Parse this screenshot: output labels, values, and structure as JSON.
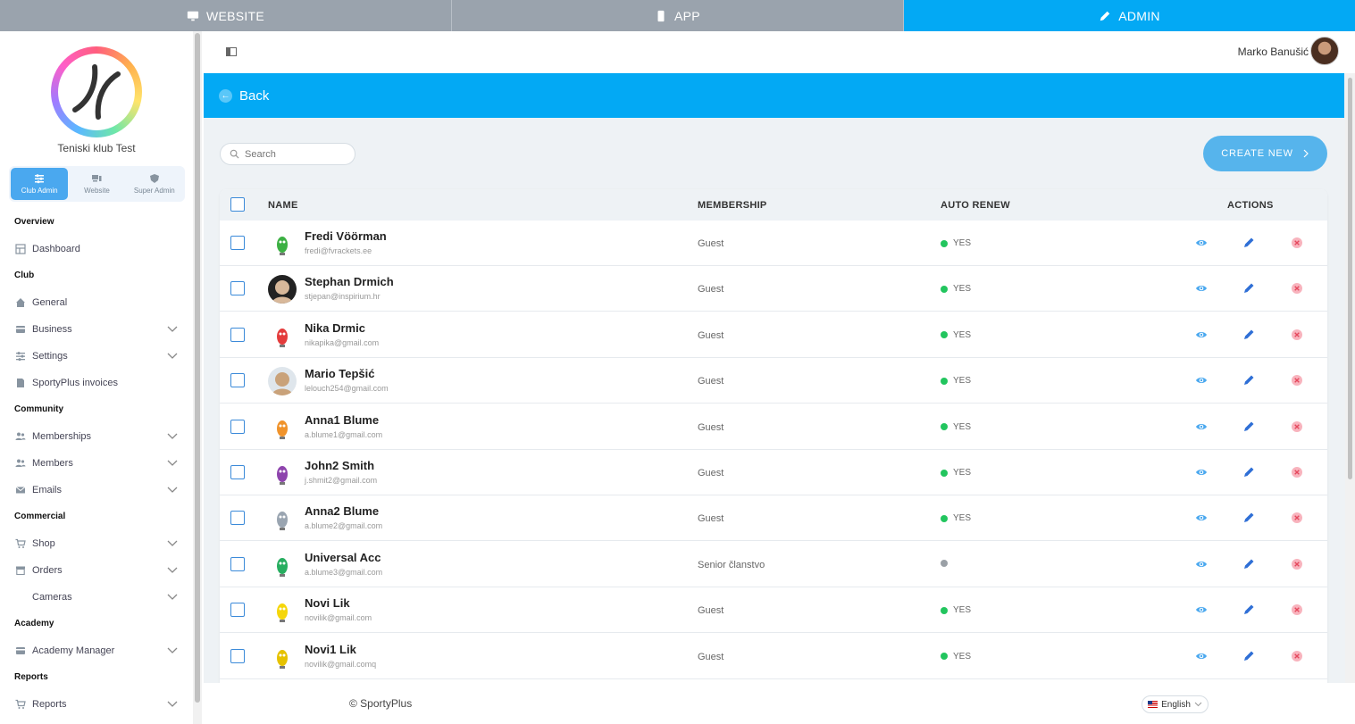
{
  "topbar": {
    "tabs": [
      {
        "label": "WEBSITE",
        "icon": "monitor-icon"
      },
      {
        "label": "APP",
        "icon": "phone-icon"
      },
      {
        "label": "ADMIN",
        "icon": "pencil-icon",
        "active": true
      }
    ]
  },
  "sidebar": {
    "club_name": "Teniski klub Test",
    "roles": [
      {
        "label": "Club Admin",
        "active": true
      },
      {
        "label": "Website"
      },
      {
        "label": "Super Admin"
      }
    ],
    "sections": {
      "overview": "Overview",
      "club": "Club",
      "community": "Community",
      "commercial": "Commercial",
      "academy": "Academy",
      "reports": "Reports"
    },
    "items": {
      "dashboard": "Dashboard",
      "general": "General",
      "business": "Business",
      "settings": "Settings",
      "invoices": "SportyPlus invoices",
      "memberships": "Memberships",
      "members": "Members",
      "emails": "Emails",
      "shop": "Shop",
      "orders": "Orders",
      "cameras": "Cameras",
      "academy_manager": "Academy Manager",
      "reports": "Reports"
    }
  },
  "header": {
    "user_name": "Marko Banušić"
  },
  "back": {
    "label": "Back"
  },
  "toolbar": {
    "search_placeholder": "Search",
    "create_label": "CREATE NEW"
  },
  "table": {
    "headers": {
      "name": "NAME",
      "membership": "MEMBERSHIP",
      "auto_renew": "AUTO RENEW",
      "actions": "ACTIONS"
    },
    "rows": [
      {
        "name": "Fredi Vöörman",
        "email": "fredi@fvrackets.ee",
        "membership": "Guest",
        "auto_renew": "YES",
        "active": true
      },
      {
        "name": "Stephan Drmich",
        "email": "stjepan@inspirium.hr",
        "membership": "Guest",
        "auto_renew": "YES",
        "active": true
      },
      {
        "name": "Nika Drmic",
        "email": "nikapika@gmail.com",
        "membership": "Guest",
        "auto_renew": "YES",
        "active": true
      },
      {
        "name": "Mario Tepšić",
        "email": "lelouch254@gmail.com",
        "membership": "Guest",
        "auto_renew": "YES",
        "active": true
      },
      {
        "name": "Anna1 Blume",
        "email": "a.blume1@gmail.com",
        "membership": "Guest",
        "auto_renew": "YES",
        "active": true
      },
      {
        "name": "John2 Smith",
        "email": "j.shmit2@gmail.com",
        "membership": "Guest",
        "auto_renew": "YES",
        "active": true
      },
      {
        "name": "Anna2 Blume",
        "email": "a.blume2@gmail.com",
        "membership": "Guest",
        "auto_renew": "YES",
        "active": true
      },
      {
        "name": "Universal Acc",
        "email": "a.blume3@gmail.com",
        "membership": "Senior članstvo",
        "auto_renew": "",
        "active": false
      },
      {
        "name": "Novi Lik",
        "email": "novilik@gmail.com",
        "membership": "Guest",
        "auto_renew": "YES",
        "active": true
      },
      {
        "name": "Novi1 Lik",
        "email": "novilik@gmail.comq",
        "membership": "Guest",
        "auto_renew": "YES",
        "active": true
      }
    ]
  },
  "footer": {
    "copyright": "© SportyPlus",
    "language": "English"
  },
  "colors": {
    "accent": "#03a9f4",
    "button": "#56b4ec",
    "active_dot": "#22c55e",
    "delete": "#f36b7f"
  }
}
